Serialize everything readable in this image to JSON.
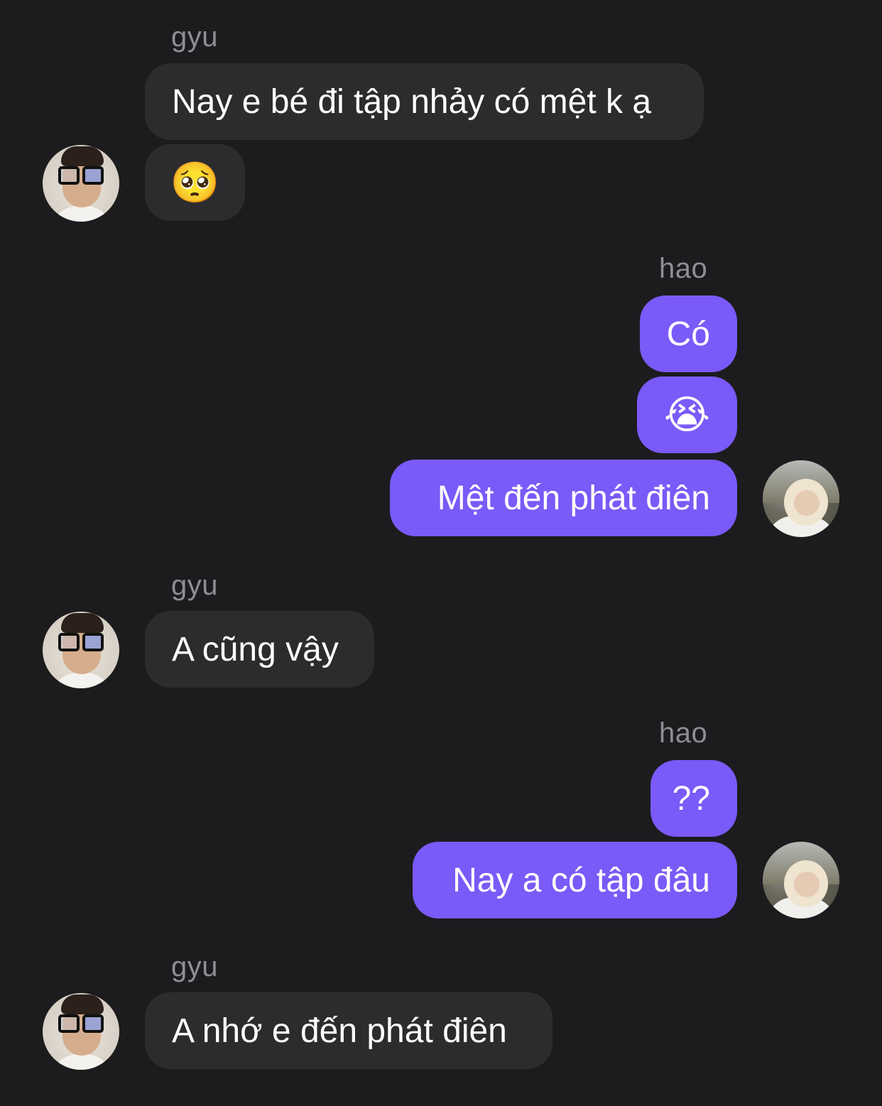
{
  "chat": {
    "groups": [
      {
        "sender": "gyu",
        "messages": [
          "Nay e bé đi tập nhảy có mệt k ạ",
          "🥺"
        ]
      },
      {
        "sender": "hao",
        "messages": [
          "Có",
          "😭",
          "Mệt đến phát điên"
        ]
      },
      {
        "sender": "gyu",
        "messages": [
          "A cũng vậy"
        ]
      },
      {
        "sender": "hao",
        "messages": [
          "??",
          "Nay a có tập đâu"
        ]
      },
      {
        "sender": "gyu",
        "messages": [
          "A nhớ e đến phát điên"
        ]
      }
    ]
  },
  "colors": {
    "background": "#1c1c1e",
    "incoming_bubble": "#2c2c2e",
    "outgoing_bubble": "#7a5af8",
    "sender_label": "#8e8e93"
  },
  "icons": {
    "gyu_avatar": "user-avatar-photo",
    "hao_avatar": "user-avatar-photo"
  }
}
